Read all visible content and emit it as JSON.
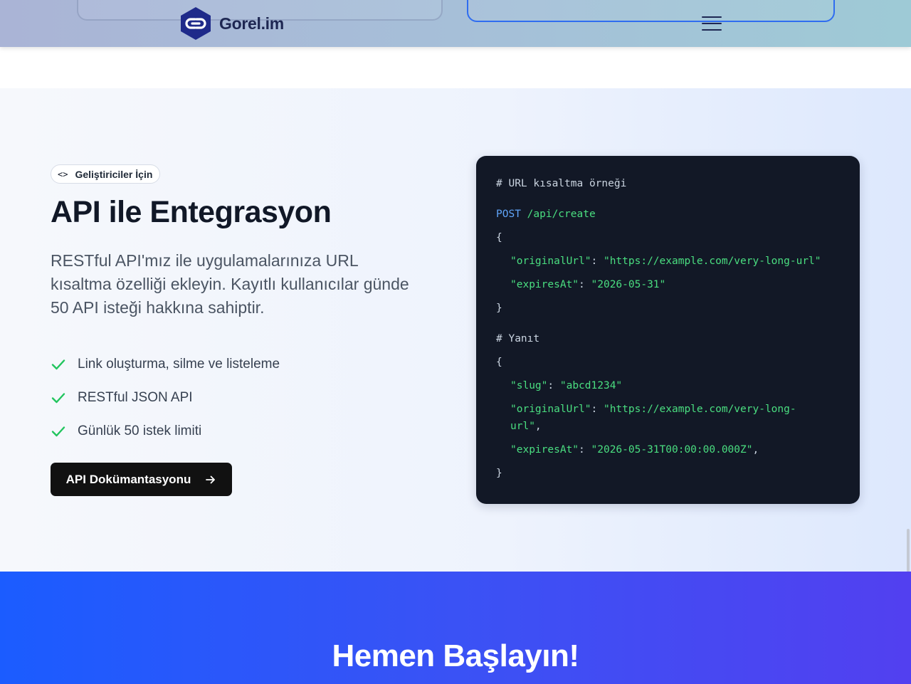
{
  "header": {
    "logo_text": "Gorel.im",
    "brand_color": "#1e2752",
    "menu_icon": "hamburger-menu-icon"
  },
  "api": {
    "tag_icon": "<>",
    "tag_label": "Geliştiriciler İçin",
    "title": "API ile Entegrasyon",
    "description": "RESTful API'mız ile uygulamalarınıza URL kısaltma özelliği ekleyin. Kayıtlı kullanıcılar günde 50 API isteği hakkına sahiptir.",
    "features": [
      "Link oluşturma, silme ve listeleme",
      "RESTful JSON API",
      "Günlük 50 istek limiti"
    ],
    "button_label": "API Dokümantasyonu",
    "button_icon": "→",
    "check_color": "#22c55e"
  },
  "code": {
    "comment1": "# URL kısaltma örneği",
    "method": "POST",
    "path": " /api/create",
    "open1": "{",
    "req_key1": "\"originalUrl\"",
    "req_val1": "\"https://example.com/very-long-url\"",
    "req_key2": "\"expiresAt\"",
    "req_val2": "\"2026-05-31\"",
    "close1": "}",
    "comment2": "# Yanıt",
    "open2": "{",
    "res_key1": "\"slug\"",
    "res_val1": "\"abcd1234\"",
    "res_key2": "\"originalUrl\"",
    "res_val2a": "\"https://example.com/very-long-",
    "res_val2b": "url\"",
    "res_key3": "\"expiresAt\"",
    "res_val3": "\"2026-05-31T00:00:00.000Z\"",
    "close2": "}",
    "colon": ": ",
    "comma": ","
  },
  "cta": {
    "title": "Hemen Başlayın!"
  }
}
